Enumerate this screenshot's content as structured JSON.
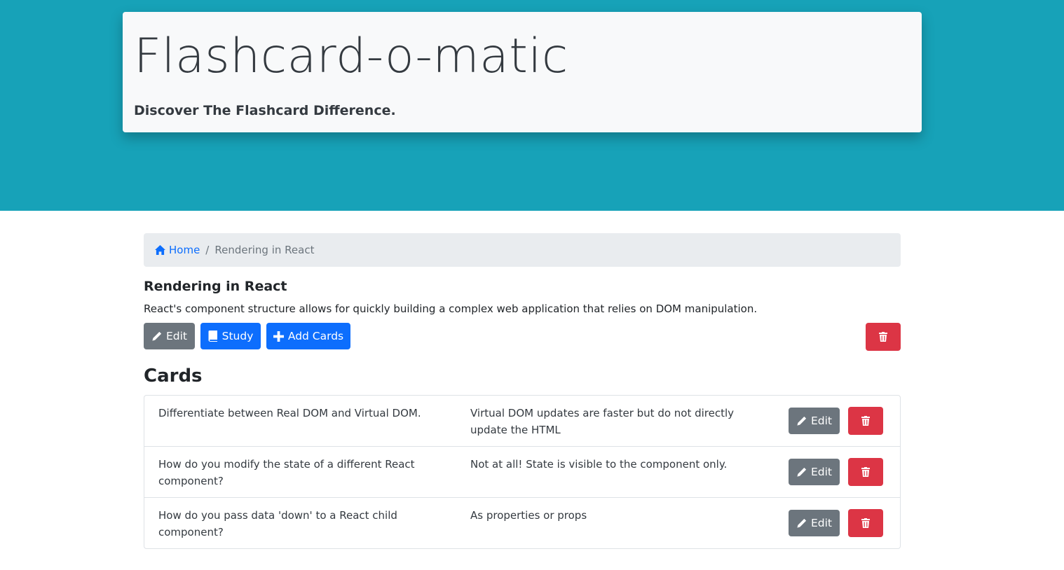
{
  "header": {
    "title": "Flashcard-o-matic",
    "tagline": "Discover The Flashcard Difference."
  },
  "breadcrumb": {
    "home_label": "Home",
    "separator": "/",
    "current": "Rendering in React"
  },
  "deck": {
    "name": "Rendering in React",
    "description": "React's component structure allows for quickly building a complex web application that relies on DOM manipulation.",
    "edit_label": "Edit",
    "study_label": "Study",
    "add_cards_label": "Add Cards"
  },
  "cards_heading": "Cards",
  "cards": [
    {
      "front": "Differentiate between Real DOM and Virtual DOM.",
      "back": "Virtual DOM updates are faster but do not directly update the HTML",
      "edit_label": "Edit"
    },
    {
      "front": "How do you modify the state of a different React component?",
      "back": "Not at all! State is visible to the component only.",
      "edit_label": "Edit"
    },
    {
      "front": "How do you pass data 'down' to a React child component?",
      "back": "As properties or props",
      "edit_label": "Edit"
    }
  ],
  "icons": {
    "home": "home-icon",
    "edit": "pencil-icon",
    "study": "book-icon",
    "add": "plus-icon",
    "delete": "trash-icon"
  },
  "colors": {
    "hero_bg": "#17a2b8",
    "jumbotron_bg": "#f8f9fa",
    "primary": "#0d6efd",
    "secondary": "#6c757d",
    "danger": "#dc3545",
    "breadcrumb_bg": "#e9ecef"
  }
}
